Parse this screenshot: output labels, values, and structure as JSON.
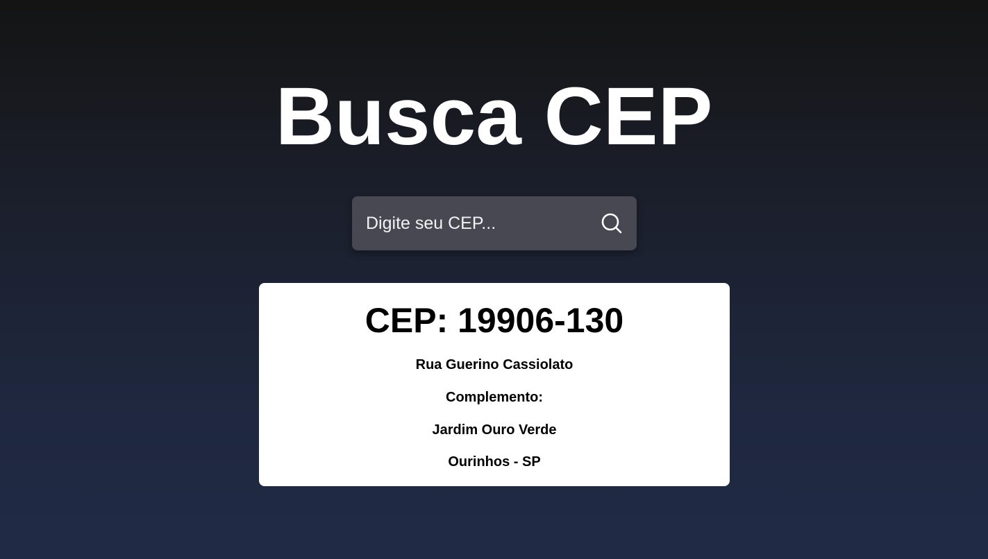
{
  "page": {
    "title": "Busca CEP"
  },
  "search": {
    "placeholder": "Digite seu CEP...",
    "value": "",
    "button_icon": "search-icon"
  },
  "result": {
    "cep_heading": "CEP: 19906-130",
    "street": "Rua Guerino Cassiolato",
    "complement": "Complemento:",
    "neighborhood": "Jardim Ouro Verde",
    "city_state": "Ourinhos - SP"
  },
  "colors": {
    "background_top": "#141414",
    "background_bottom": "#212a45",
    "search_box": "#474851",
    "card": "#ffffff",
    "title_text": "#ffffff",
    "card_text": "#000000"
  }
}
